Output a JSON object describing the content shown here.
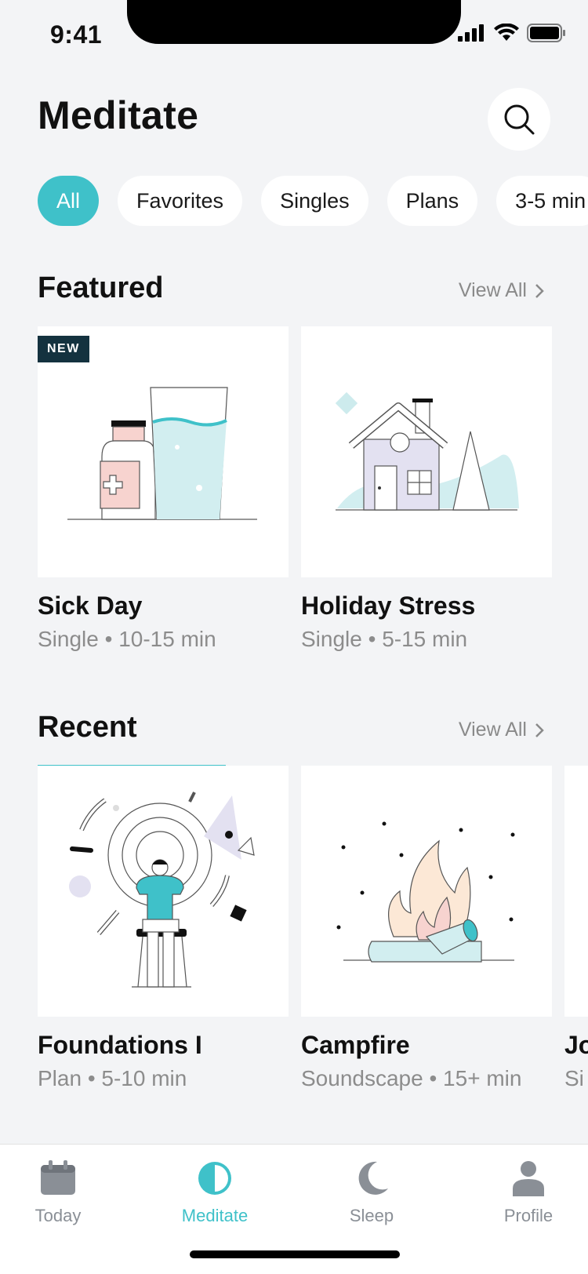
{
  "status": {
    "time": "9:41"
  },
  "header": {
    "title": "Meditate"
  },
  "filters": [
    "All",
    "Favorites",
    "Singles",
    "Plans",
    "3-5 min"
  ],
  "featured": {
    "title": "Featured",
    "view_all": "View All",
    "items": [
      {
        "badge": "NEW",
        "title": "Sick Day",
        "meta": "Single • 10-15 min"
      },
      {
        "title": "Holiday Stress",
        "meta": "Single • 5-15 min"
      }
    ]
  },
  "recent": {
    "title": "Recent",
    "view_all": "View All",
    "items": [
      {
        "title": "Foundations I",
        "meta": "Plan • 5-10 min",
        "progress": 0.75
      },
      {
        "title": "Campfire",
        "meta": "Soundscape • 15+ min"
      },
      {
        "title": "Jo",
        "meta": "Si"
      }
    ]
  },
  "tabs": [
    {
      "label": "Today",
      "icon": "calendar-icon"
    },
    {
      "label": "Meditate",
      "icon": "meditate-icon",
      "active": true
    },
    {
      "label": "Sleep",
      "icon": "moon-icon"
    },
    {
      "label": "Profile",
      "icon": "person-icon"
    }
  ],
  "colors": {
    "accent": "#3fc1c9",
    "background": "#f3f4f6",
    "badge": "#14323f"
  }
}
